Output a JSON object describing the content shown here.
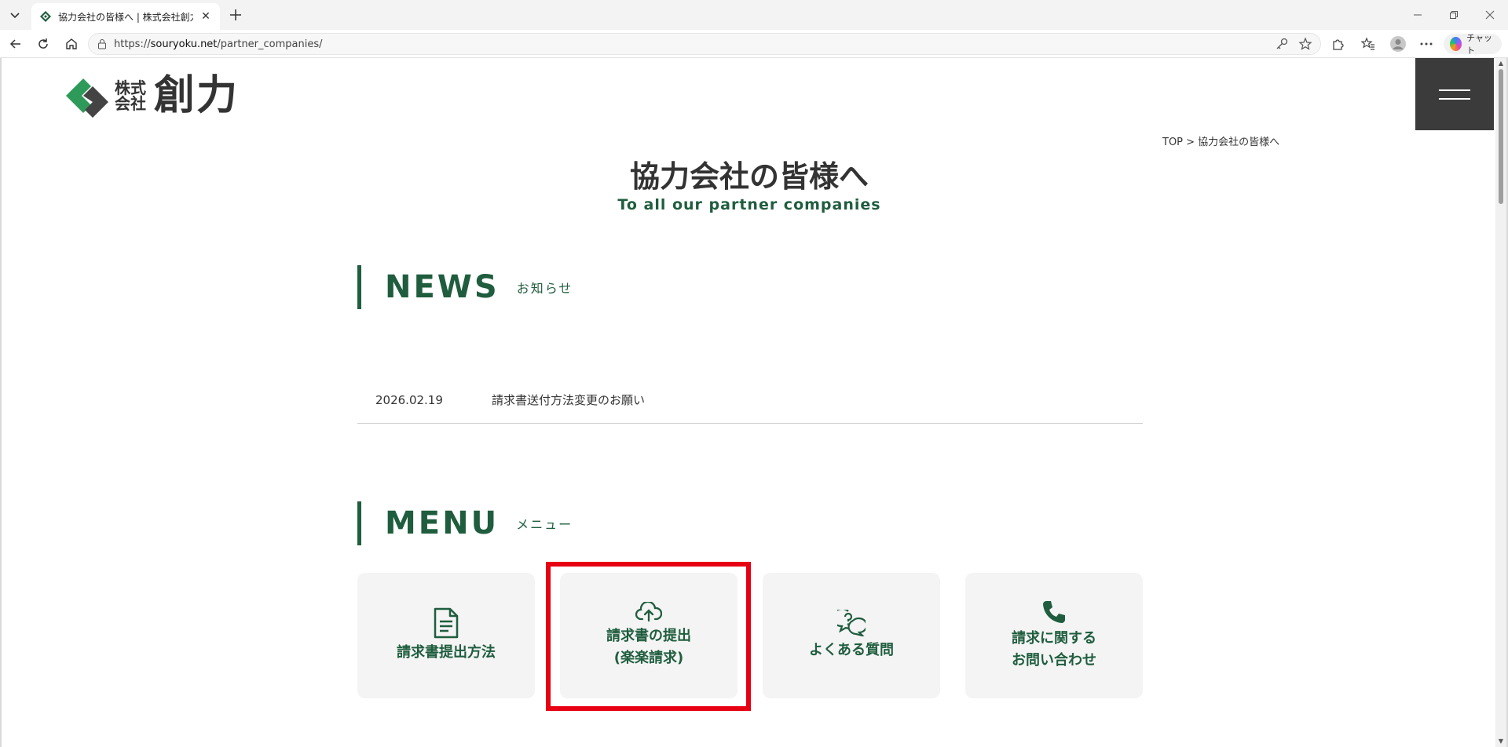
{
  "browser": {
    "tab_title": "協力会社の皆様へ | 株式会社創力",
    "url_prefix": "https://",
    "url_domain": "souryoku.net",
    "url_path": "/partner_companies/",
    "chat_label": "チャット"
  },
  "page": {
    "logo_small": "株式\n会社",
    "logo_big": "創力",
    "breadcrumb": "TOP > 協力会社の皆様へ",
    "title": "協力会社の皆様へ",
    "subtitle": "To all our partner companies",
    "news_heading_en": "NEWS",
    "news_heading_ja": "お知らせ",
    "news": [
      {
        "date": "2026.02.19",
        "title": "請求書送付方法変更のお願い"
      }
    ],
    "menu_heading_en": "MENU",
    "menu_heading_ja": "メニュー",
    "menu": [
      {
        "label": "請求書提出方法",
        "icon": "document-icon"
      },
      {
        "label": "請求書の提出\n(楽楽請求)",
        "icon": "cloud-upload-icon"
      },
      {
        "label": "よくある質問",
        "icon": "question-bubble-icon"
      },
      {
        "label": "請求に関する\nお問い合わせ",
        "icon": "phone-icon"
      }
    ],
    "accent_color": "#1f5d3e",
    "highlight_color": "#e60012"
  }
}
